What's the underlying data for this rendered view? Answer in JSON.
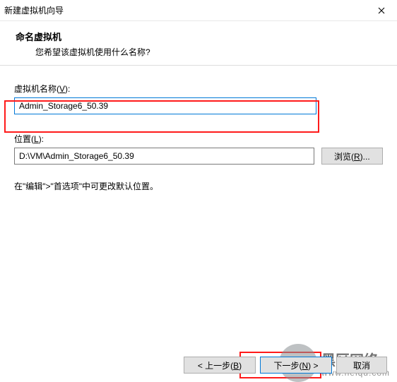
{
  "window": {
    "title": "新建虚拟机向导"
  },
  "header": {
    "title": "命名虚拟机",
    "subtitle": "您希望该虚拟机使用什么名称?"
  },
  "vm_name": {
    "label_prefix": "虚拟机名称(",
    "accel": "V",
    "label_suffix": "):",
    "value": "Admin_Storage6_50.39"
  },
  "location": {
    "label_prefix": "位置(",
    "accel": "L",
    "label_suffix": "):",
    "value": "D:\\VM\\Admin_Storage6_50.39",
    "browse_prefix": "浏览(",
    "browse_accel": "R",
    "browse_suffix": ")..."
  },
  "helper": "在\"编辑\">\"首选项\"中可更改默认位置。",
  "buttons": {
    "back_prefix": "< 上一步(",
    "back_accel": "B",
    "back_suffix": ")",
    "next_prefix": "下一步(",
    "next_accel": "N",
    "next_suffix": ") >",
    "cancel": "取消"
  },
  "watermark": {
    "line1": "黑区网络",
    "line2": "www.heiqu.com"
  }
}
